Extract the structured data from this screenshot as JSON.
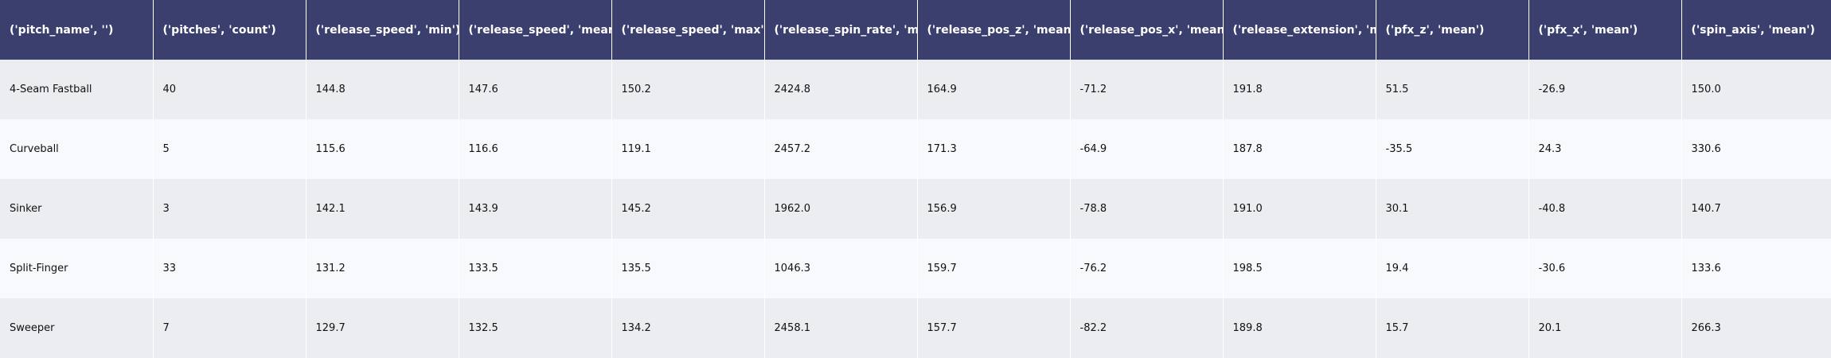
{
  "chart_data": {
    "type": "table",
    "columns": [
      "('pitch_name', '')",
      "('pitches', 'count')",
      "('release_speed', 'min')",
      "('release_speed', 'mean')",
      "('release_speed', 'max')",
      "('release_spin_rate', 'mean')",
      "('release_pos_z', 'mean')",
      "('release_pos_x', 'mean')",
      "('release_extension', 'mean')",
      "('pfx_z', 'mean')",
      "('pfx_x', 'mean')",
      "('spin_axis', 'mean')"
    ],
    "rows": [
      [
        "4-Seam Fastball",
        "40",
        "144.8",
        "147.6",
        "150.2",
        "2424.8",
        "164.9",
        "-71.2",
        "191.8",
        "51.5",
        "-26.9",
        "150.0"
      ],
      [
        "Curveball",
        "5",
        "115.6",
        "116.6",
        "119.1",
        "2457.2",
        "171.3",
        "-64.9",
        "187.8",
        "-35.5",
        "24.3",
        "330.6"
      ],
      [
        "Sinker",
        "3",
        "142.1",
        "143.9",
        "145.2",
        "1962.0",
        "156.9",
        "-78.8",
        "191.0",
        "30.1",
        "-40.8",
        "140.7"
      ],
      [
        "Split-Finger",
        "33",
        "131.2",
        "133.5",
        "135.5",
        "1046.3",
        "159.7",
        "-76.2",
        "198.5",
        "19.4",
        "-30.6",
        "133.6"
      ],
      [
        "Sweeper",
        "7",
        "129.7",
        "132.5",
        "134.2",
        "2458.1",
        "157.7",
        "-82.2",
        "189.8",
        "15.7",
        "20.1",
        "266.3"
      ]
    ],
    "header_color": "#3a3f6e",
    "row_colors": [
      "#ecedf1",
      "#f8f9fc"
    ]
  }
}
